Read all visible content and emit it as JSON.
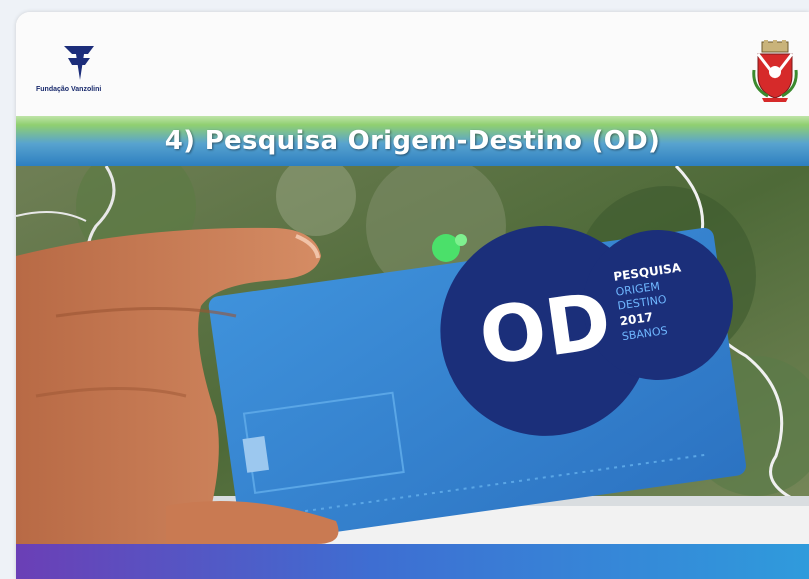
{
  "header": {
    "left_logo_text": "Fundação Vanzolini",
    "right_logo_icon": "municipal-coat-of-arms-icon"
  },
  "title_bar": {
    "title": "4) Pesquisa Origem-Destino (OD)"
  },
  "photo": {
    "card": {
      "logo_text": "OD",
      "line1": "PESQUISA",
      "line2": "ORIGEM",
      "line3": "DESTINO",
      "year": "2017",
      "line5": "SBANOS"
    }
  },
  "colors": {
    "title_gradient_top": "#8fcf70",
    "title_gradient_bottom": "#2d7fc0",
    "footer_left": "#6b3fb6",
    "footer_right": "#2f9bdc",
    "card_blue": "#2f7fcf",
    "card_dark": "#1b2f7a"
  }
}
